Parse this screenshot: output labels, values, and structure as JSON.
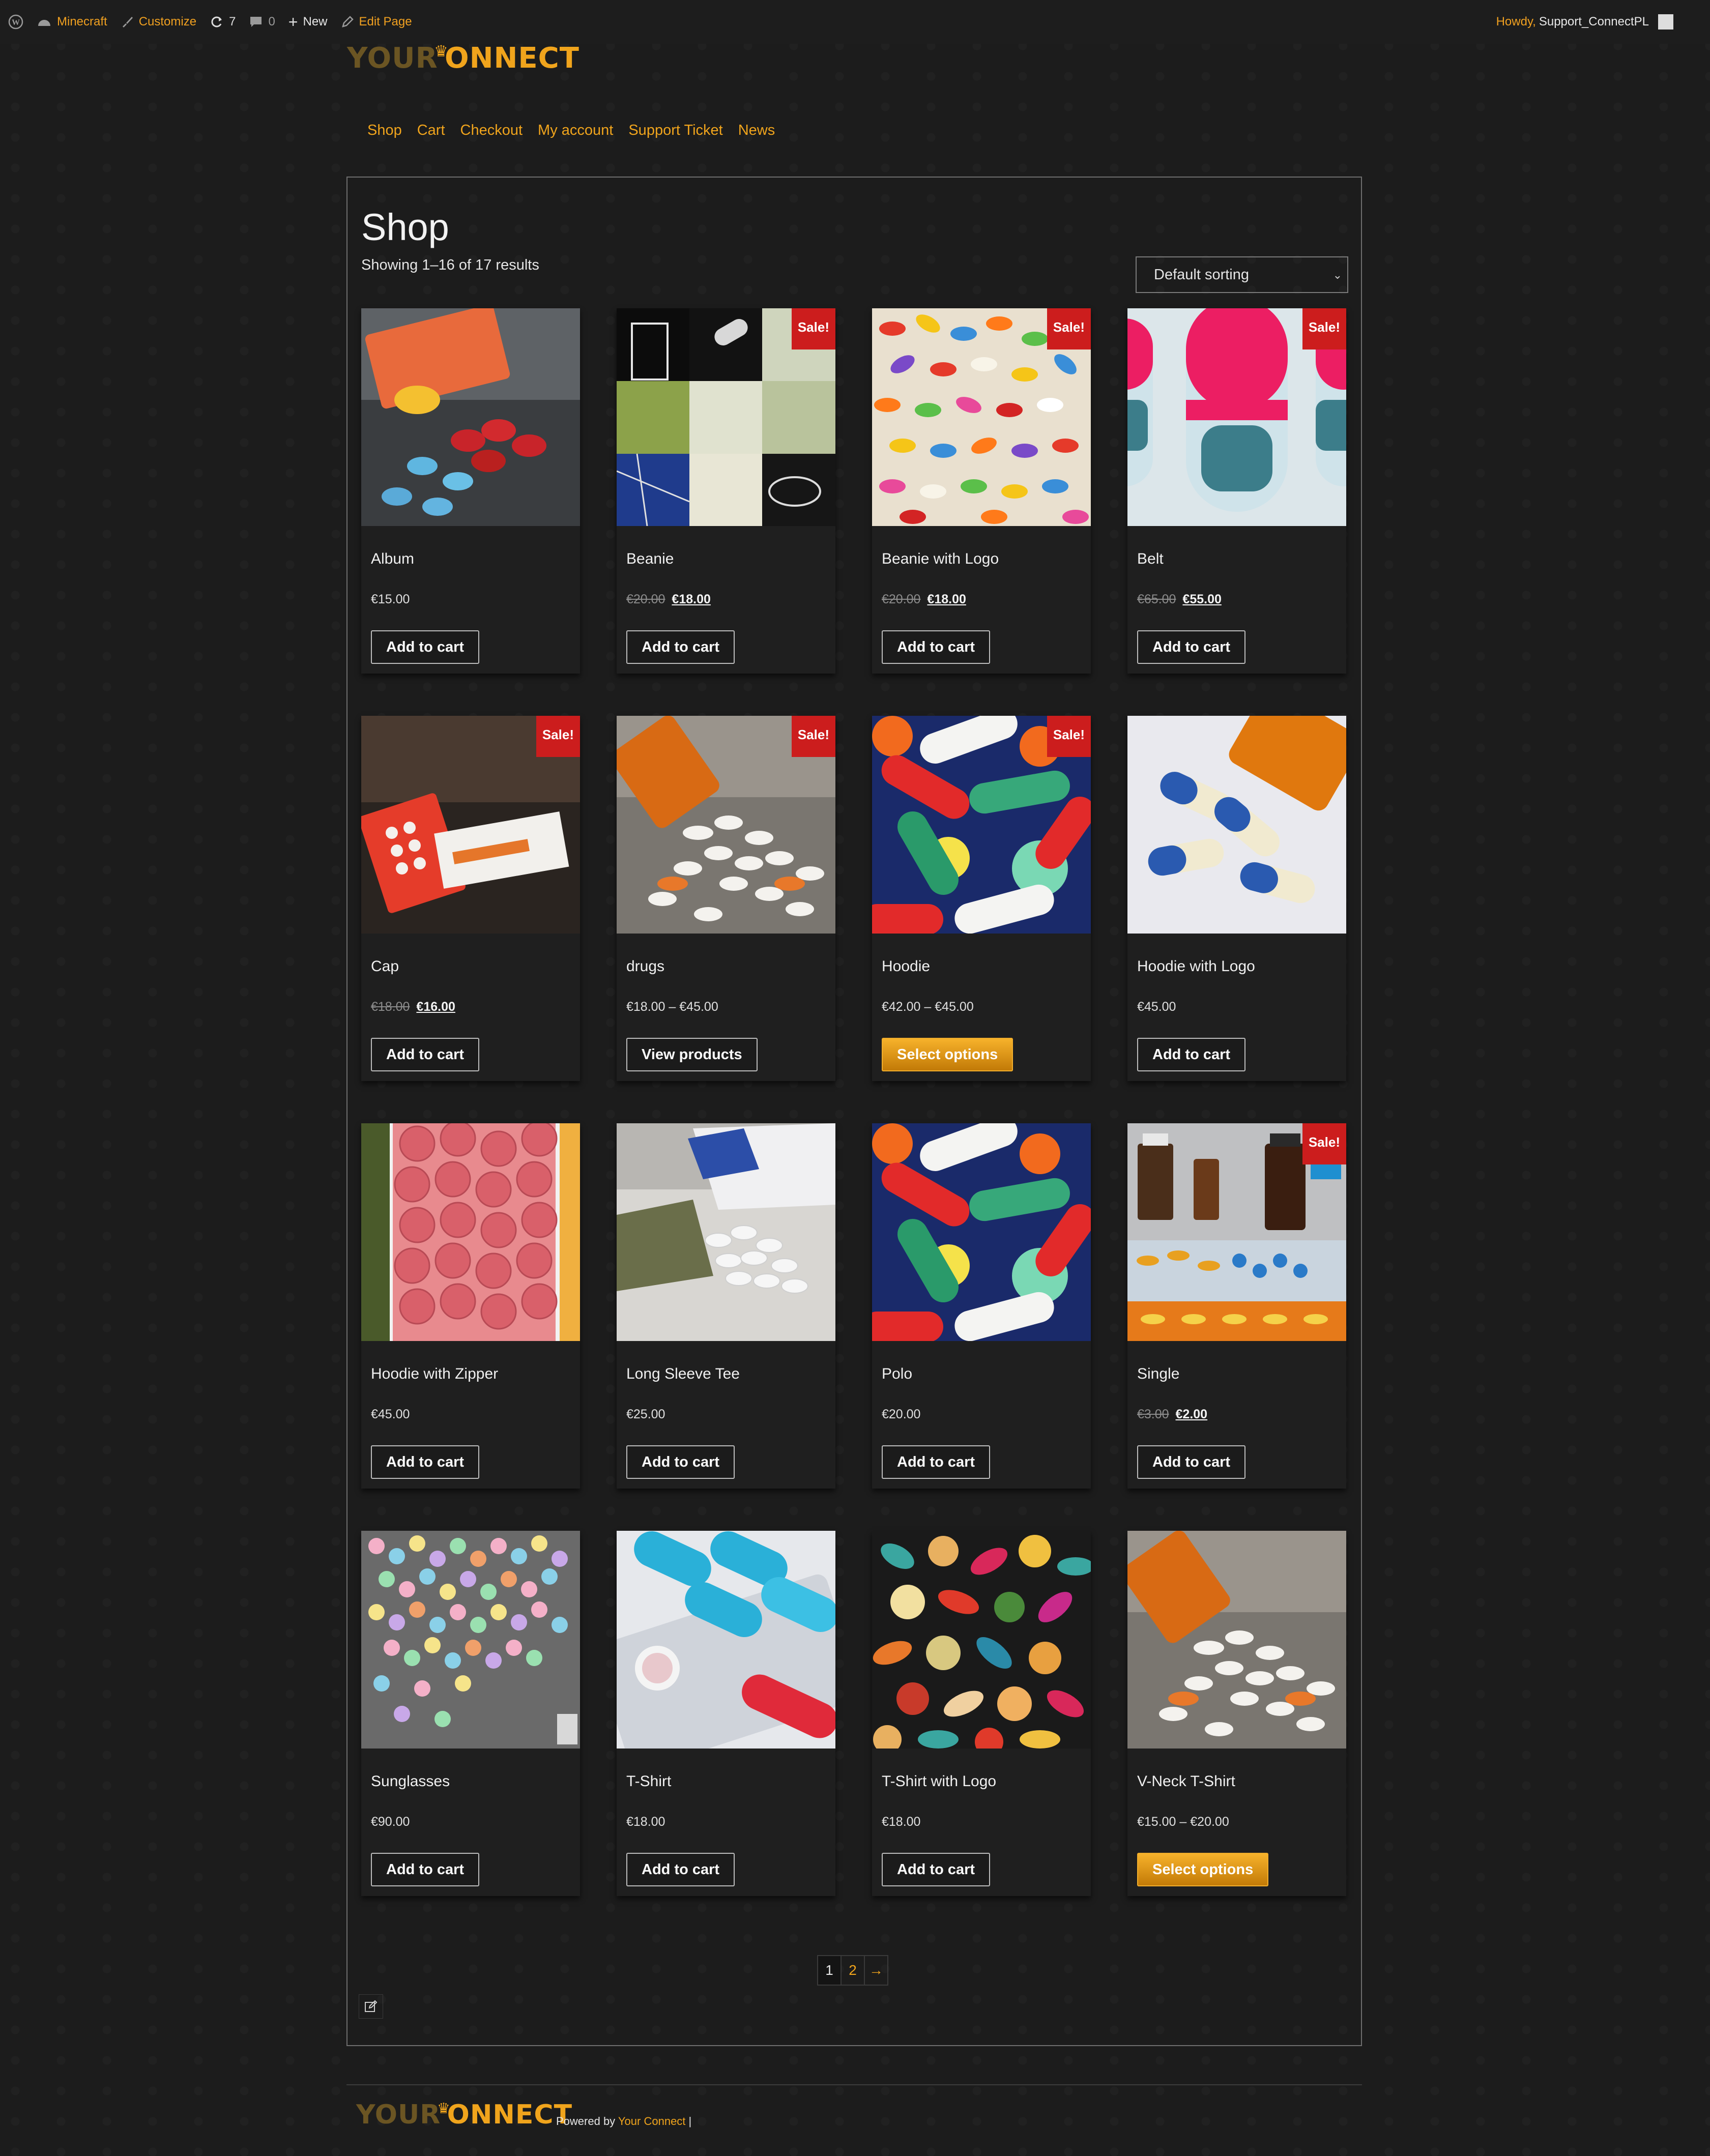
{
  "adminbar": {
    "site_name": "Minecraft",
    "customize": "Customize",
    "updates_count": "7",
    "comments_count": "0",
    "new_label": "New",
    "edit_page": "Edit Page",
    "howdy": "Howdy,",
    "username": "Support_ConnectPL"
  },
  "logo": {
    "part1": "YOUR",
    "part2": "NNECT",
    "crown": "♛"
  },
  "nav": [
    "Shop",
    "Cart",
    "Checkout",
    "My account",
    "Support Ticket",
    "News"
  ],
  "shop": {
    "title": "Shop",
    "result_count": "Showing 1–16 of 17 results",
    "sorting": "Default sorting",
    "sale_badge": "Sale!"
  },
  "products": [
    {
      "name": "Album",
      "price": "€15.00",
      "button": "Add to cart"
    },
    {
      "name": "Beanie",
      "old_price": "€20.00",
      "sale_price": "€18.00",
      "sale": true,
      "button": "Add to cart"
    },
    {
      "name": "Beanie with Logo",
      "old_price": "€20.00",
      "sale_price": "€18.00",
      "sale": true,
      "button": "Add to cart"
    },
    {
      "name": "Belt",
      "old_price": "€65.00",
      "sale_price": "€55.00",
      "sale": true,
      "button": "Add to cart"
    },
    {
      "name": "Cap",
      "old_price": "€18.00",
      "sale_price": "€16.00",
      "sale": true,
      "button": "Add to cart"
    },
    {
      "name": "drugs",
      "price": "€18.00 – €45.00",
      "sale": true,
      "button": "View products"
    },
    {
      "name": "Hoodie",
      "price": "€42.00 – €45.00",
      "sale": true,
      "button": "Select options"
    },
    {
      "name": "Hoodie with Logo",
      "price": "€45.00",
      "button": "Add to cart"
    },
    {
      "name": "Hoodie with Zipper",
      "price": "€45.00",
      "button": "Add to cart"
    },
    {
      "name": "Long Sleeve Tee",
      "price": "€25.00",
      "button": "Add to cart"
    },
    {
      "name": "Polo",
      "price": "€20.00",
      "button": "Add to cart"
    },
    {
      "name": "Single",
      "old_price": "€3.00",
      "sale_price": "€2.00",
      "sale": true,
      "button": "Add to cart"
    },
    {
      "name": "Sunglasses",
      "price": "€90.00",
      "button": "Add to cart"
    },
    {
      "name": "T-Shirt",
      "price": "€18.00",
      "button": "Add to cart"
    },
    {
      "name": "T-Shirt with Logo",
      "price": "€18.00",
      "button": "Add to cart"
    },
    {
      "name": "V-Neck T-Shirt",
      "price": "€15.00 – €20.00",
      "button": "Select options"
    }
  ],
  "pagination": {
    "page1": "1",
    "page2": "2",
    "next": "→"
  },
  "footer": {
    "powered_by": "Powered by",
    "link": "Your Connect",
    "sep": "|"
  },
  "colors": {
    "accent": "#f0a41c",
    "sale": "#cc1d1d",
    "background": "#1c1c1c"
  }
}
